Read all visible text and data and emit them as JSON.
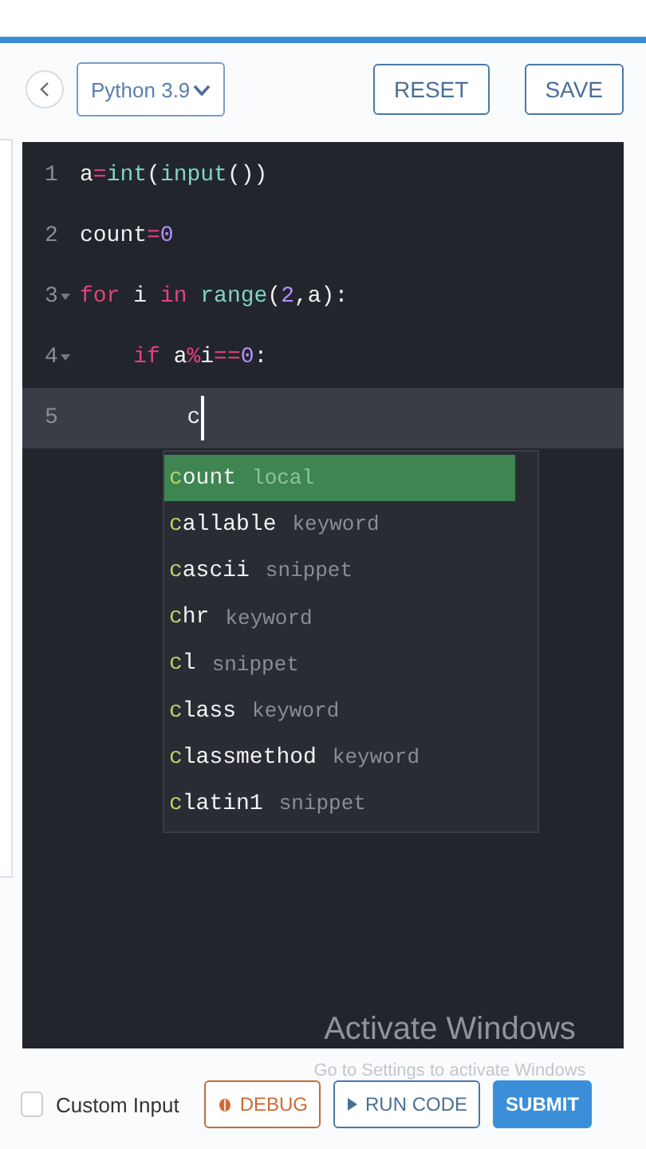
{
  "toolbar": {
    "language": "Python 3.9",
    "buttons": [
      {
        "label": "RESET"
      },
      {
        "label": "SAVE"
      }
    ]
  },
  "editor": {
    "lines": [
      {
        "number": "1",
        "foldable": false,
        "active": false,
        "tokens": [
          {
            "kind": "plain",
            "text": "a"
          },
          {
            "kind": "operator",
            "text": "="
          },
          {
            "kind": "builtin",
            "text": "int"
          },
          {
            "kind": "plain",
            "text": "("
          },
          {
            "kind": "builtin",
            "text": "input"
          },
          {
            "kind": "plain",
            "text": "())"
          }
        ]
      },
      {
        "number": "2",
        "foldable": false,
        "active": false,
        "tokens": [
          {
            "kind": "plain",
            "text": "count"
          },
          {
            "kind": "operator",
            "text": "="
          },
          {
            "kind": "number",
            "text": "0"
          }
        ]
      },
      {
        "number": "3",
        "foldable": true,
        "active": false,
        "tokens": [
          {
            "kind": "keyword",
            "text": "for"
          },
          {
            "kind": "plain",
            "text": " i "
          },
          {
            "kind": "keyword",
            "text": "in"
          },
          {
            "kind": "builtin",
            "text": " range"
          },
          {
            "kind": "plain",
            "text": "("
          },
          {
            "kind": "number",
            "text": "2"
          },
          {
            "kind": "plain",
            "text": ",a):"
          }
        ]
      },
      {
        "number": "4",
        "foldable": true,
        "active": false,
        "tokens": [
          {
            "kind": "keyword",
            "text": "    if"
          },
          {
            "kind": "plain",
            "text": " a"
          },
          {
            "kind": "operator",
            "text": "%"
          },
          {
            "kind": "plain",
            "text": "i"
          },
          {
            "kind": "operator",
            "text": "=="
          },
          {
            "kind": "number",
            "text": "0"
          },
          {
            "kind": "plain",
            "text": ":"
          }
        ]
      },
      {
        "number": "5",
        "foldable": false,
        "active": true,
        "tokens": [
          {
            "kind": "plain",
            "text": "        c"
          }
        ]
      }
    ],
    "autocomplete": [
      {
        "match": "c",
        "rest": "ount",
        "type": "local",
        "selected": true
      },
      {
        "match": "c",
        "rest": "allable",
        "type": "keyword",
        "selected": false
      },
      {
        "match": "c",
        "rest": "ascii",
        "type": "snippet",
        "selected": false
      },
      {
        "match": "c",
        "rest": "hr",
        "type": "keyword",
        "selected": false
      },
      {
        "match": "c",
        "rest": "l",
        "type": "snippet",
        "selected": false
      },
      {
        "match": "c",
        "rest": "lass",
        "type": "keyword",
        "selected": false
      },
      {
        "match": "c",
        "rest": "lassmethod",
        "type": "keyword",
        "selected": false
      },
      {
        "match": "c",
        "rest": "latin1",
        "type": "snippet",
        "selected": false
      }
    ]
  },
  "overlay": {
    "title": "Activate Windows",
    "subtitle": "Go to Settings to activate Windows"
  },
  "footer": {
    "custom_input": {
      "label": "Custom Input",
      "checked": false
    },
    "buttons": [
      {
        "kind": "debug",
        "label": "DEBUG"
      },
      {
        "kind": "run",
        "label": "RUN CODE"
      },
      {
        "kind": "submit",
        "label": "SUBMIT"
      }
    ]
  }
}
